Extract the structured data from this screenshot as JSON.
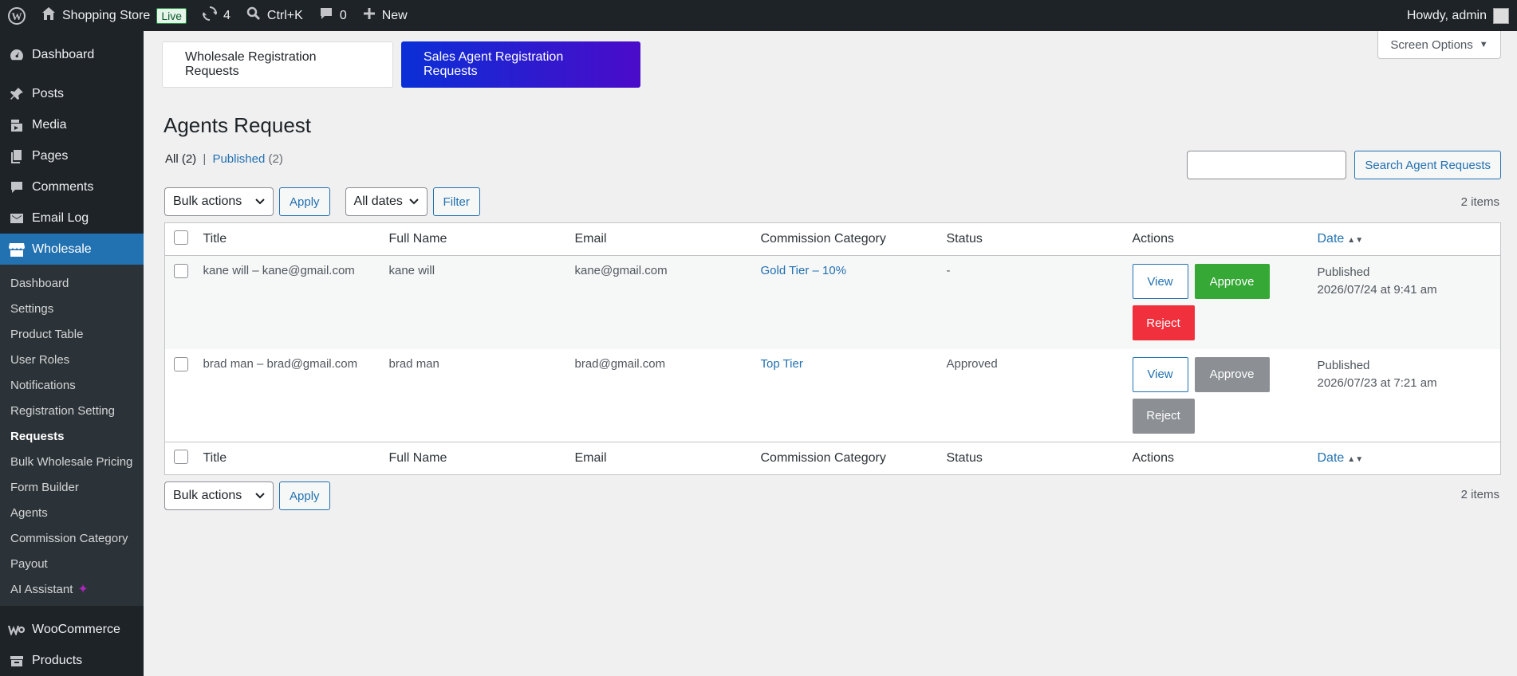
{
  "adminbar": {
    "site_name": "Shopping Store",
    "live_badge": "Live",
    "updates_count": "4",
    "search_shortcut": "Ctrl+K",
    "comments_count": "0",
    "new_label": "New",
    "howdy": "Howdy, admin"
  },
  "sidebar": {
    "items": [
      {
        "label": "Dashboard",
        "icon": "dashboard-icon"
      },
      {
        "label": "Posts",
        "icon": "pin-icon"
      },
      {
        "label": "Media",
        "icon": "media-icon"
      },
      {
        "label": "Pages",
        "icon": "pages-icon"
      },
      {
        "label": "Comments",
        "icon": "comment-icon"
      },
      {
        "label": "Email Log",
        "icon": "email-icon"
      },
      {
        "label": "Wholesale",
        "icon": "store-icon"
      }
    ],
    "submenu": [
      "Dashboard",
      "Settings",
      "Product Table",
      "User Roles",
      "Notifications",
      "Registration Setting",
      "Requests",
      "Bulk Wholesale Pricing",
      "Form Builder",
      "Agents",
      "Commission Category",
      "Payout",
      "AI Assistant"
    ],
    "bottom": [
      {
        "label": "WooCommerce",
        "icon": "woo-icon"
      },
      {
        "label": "Products",
        "icon": "products-icon"
      }
    ]
  },
  "tabs": {
    "wholesale": "Wholesale Registration Requests",
    "sales_agent": "Sales Agent Registration Requests"
  },
  "screen_options": "Screen Options",
  "page_title": "Agents Request",
  "views": {
    "all": "All",
    "all_count": "(2)",
    "sep": "|",
    "published": "Published",
    "published_count": "(2)"
  },
  "search": {
    "button": "Search Agent Requests",
    "value": ""
  },
  "tablenav_top": {
    "bulk": "Bulk actions",
    "apply": "Apply",
    "dates": "All dates",
    "filter": "Filter",
    "count": "2 items"
  },
  "tablenav_bottom": {
    "bulk": "Bulk actions",
    "apply": "Apply",
    "count": "2 items"
  },
  "columns": [
    "Title",
    "Full Name",
    "Email",
    "Commission Category",
    "Status",
    "Actions",
    "Date"
  ],
  "rows": [
    {
      "title": "kane will – kane@gmail.com",
      "full_name": "kane will",
      "email": "kane@gmail.com",
      "category": "Gold Tier – 10%",
      "status": "-",
      "view": "View",
      "approve": "Approve",
      "reject": "Reject",
      "date_status": "Published",
      "date": "2026/07/24 at 9:41 am"
    },
    {
      "title": "brad man – brad@gmail.com",
      "full_name": "brad man",
      "email": "brad@gmail.com",
      "category": "Top Tier",
      "status": "Approved",
      "view": "View",
      "approve": "Approve",
      "reject": "Reject",
      "date_status": "Published",
      "date": "2026/07/23 at 7:21 am"
    }
  ]
}
